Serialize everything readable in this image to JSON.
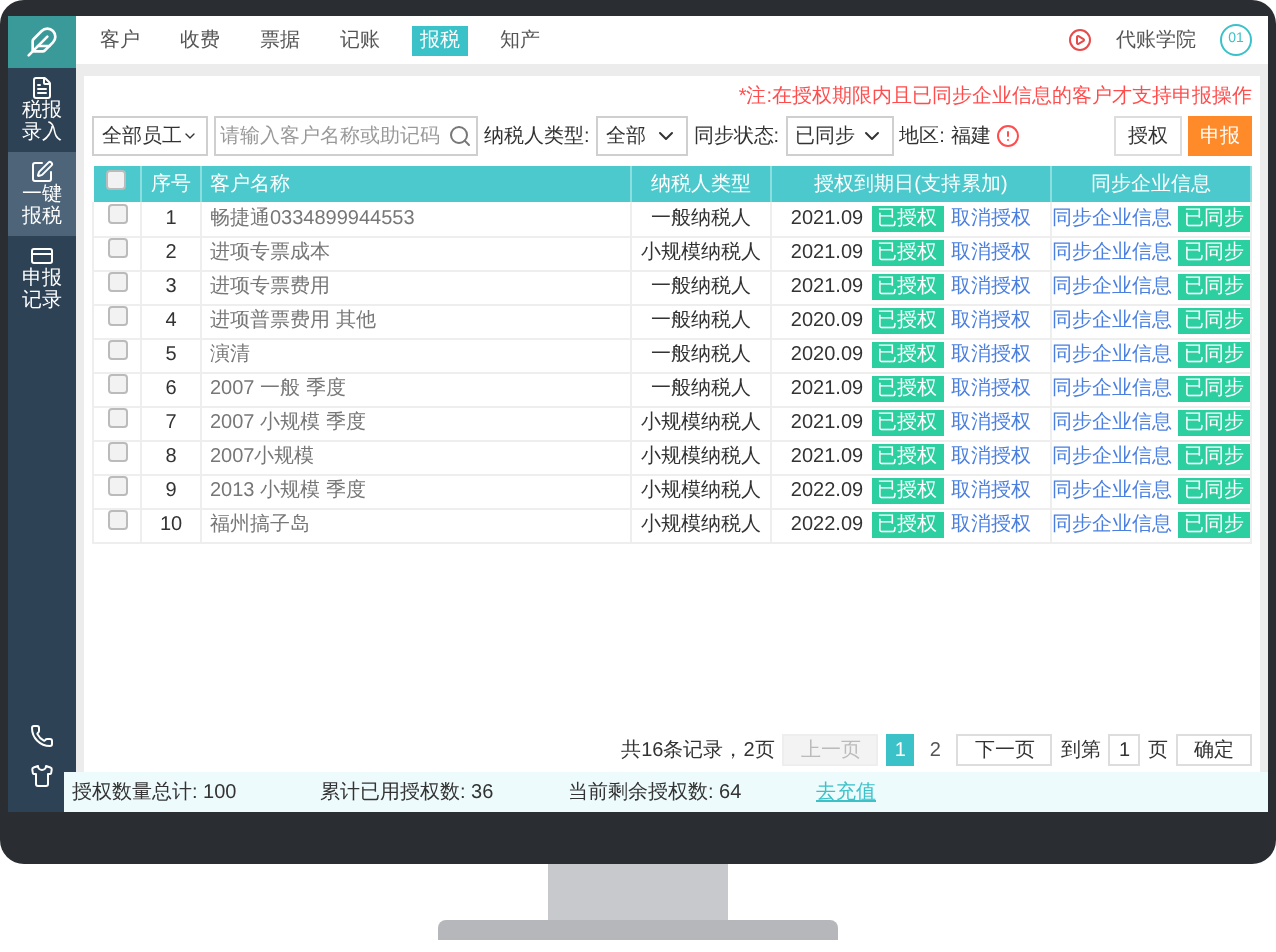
{
  "nav": {
    "tabs": [
      {
        "label": "客户",
        "selected": false
      },
      {
        "label": "收费",
        "selected": false
      },
      {
        "label": "票据",
        "selected": false
      },
      {
        "label": "记账",
        "selected": false
      },
      {
        "label": "报税",
        "selected": true
      },
      {
        "label": "知产",
        "selected": false
      }
    ],
    "academy": "代账学院",
    "avatar": "01"
  },
  "sidebar": {
    "items": [
      {
        "label": "税报录入",
        "selected": false
      },
      {
        "label": "一键报税",
        "selected": true
      },
      {
        "label": "申报记录",
        "selected": false
      }
    ]
  },
  "note": "*注:在授权期限内且已同步企业信息的客户才支持申报操作",
  "filters": {
    "employee": "全部员工",
    "search": {
      "placeholder": "请输入客户名称或助记码"
    },
    "taxpayer_label": "纳税人类型:",
    "taxpayer_value": "全部",
    "sync_label": "同步状态:",
    "sync_value": "已同步",
    "region_label": "地区:",
    "region_value": "福建",
    "authorize_button": "授权",
    "declare_button": "申报"
  },
  "table": {
    "header_checked": false,
    "columns": [
      "序号",
      "客户名称",
      "纳税人类型",
      "授权到期日(支持累加)",
      "同步企业信息"
    ],
    "rows": [
      {
        "checked": false,
        "no": "1",
        "name": "畅捷通0334899944553",
        "type": "一般纳税人",
        "expiry": "2021.09",
        "auth": "已授权",
        "cancel": "取消授权",
        "sync": "同步企业信息",
        "synced": "已同步"
      },
      {
        "checked": false,
        "no": "2",
        "name": "进项专票成本",
        "type": "小规模纳税人",
        "expiry": "2021.09",
        "auth": "已授权",
        "cancel": "取消授权",
        "sync": "同步企业信息",
        "synced": "已同步"
      },
      {
        "checked": false,
        "no": "3",
        "name": "进项专票费用",
        "type": "一般纳税人",
        "expiry": "2021.09",
        "auth": "已授权",
        "cancel": "取消授权",
        "sync": "同步企业信息",
        "synced": "已同步"
      },
      {
        "checked": false,
        "no": "4",
        "name": "进项普票费用 其他",
        "type": "一般纳税人",
        "expiry": "2020.09",
        "auth": "已授权",
        "cancel": "取消授权",
        "sync": "同步企业信息",
        "synced": "已同步"
      },
      {
        "checked": false,
        "no": "5",
        "name": "演清",
        "type": "一般纳税人",
        "expiry": "2020.09",
        "auth": "已授权",
        "cancel": "取消授权",
        "sync": "同步企业信息",
        "synced": "已同步"
      },
      {
        "checked": false,
        "no": "6",
        "name": "2007 一般 季度",
        "type": "一般纳税人",
        "expiry": "2021.09",
        "auth": "已授权",
        "cancel": "取消授权",
        "sync": "同步企业信息",
        "synced": "已同步"
      },
      {
        "checked": false,
        "no": "7",
        "name": "2007 小规模 季度",
        "type": "小规模纳税人",
        "expiry": "2021.09",
        "auth": "已授权",
        "cancel": "取消授权",
        "sync": "同步企业信息",
        "synced": "已同步"
      },
      {
        "checked": false,
        "no": "8",
        "name": "2007小规模",
        "type": "小规模纳税人",
        "expiry": "2021.09",
        "auth": "已授权",
        "cancel": "取消授权",
        "sync": "同步企业信息",
        "synced": "已同步"
      },
      {
        "checked": false,
        "no": "9",
        "name": "2013 小规模 季度",
        "type": "小规模纳税人",
        "expiry": "2022.09",
        "auth": "已授权",
        "cancel": "取消授权",
        "sync": "同步企业信息",
        "synced": "已同步"
      },
      {
        "checked": false,
        "no": "10",
        "name": "福州搞子岛",
        "type": "小规模纳税人",
        "expiry": "2022.09",
        "auth": "已授权",
        "cancel": "取消授权",
        "sync": "同步企业信息",
        "synced": "已同步"
      }
    ]
  },
  "pagination": {
    "summary": "共16条记录，2页",
    "prev": {
      "label": "上一页",
      "disabled": true
    },
    "pages": [
      {
        "label": "1",
        "selected": true
      },
      {
        "label": "2",
        "selected": false
      }
    ],
    "next": {
      "label": "下一页",
      "disabled": false
    },
    "goto_label": "到第",
    "goto_value": "1",
    "page_unit": "页",
    "confirm": "确定"
  },
  "stats": {
    "total": "授权数量总计: 100",
    "used": "累计已用授权数: 36",
    "remaining": "当前剩余授权数: 64",
    "recharge": "去充值"
  }
}
